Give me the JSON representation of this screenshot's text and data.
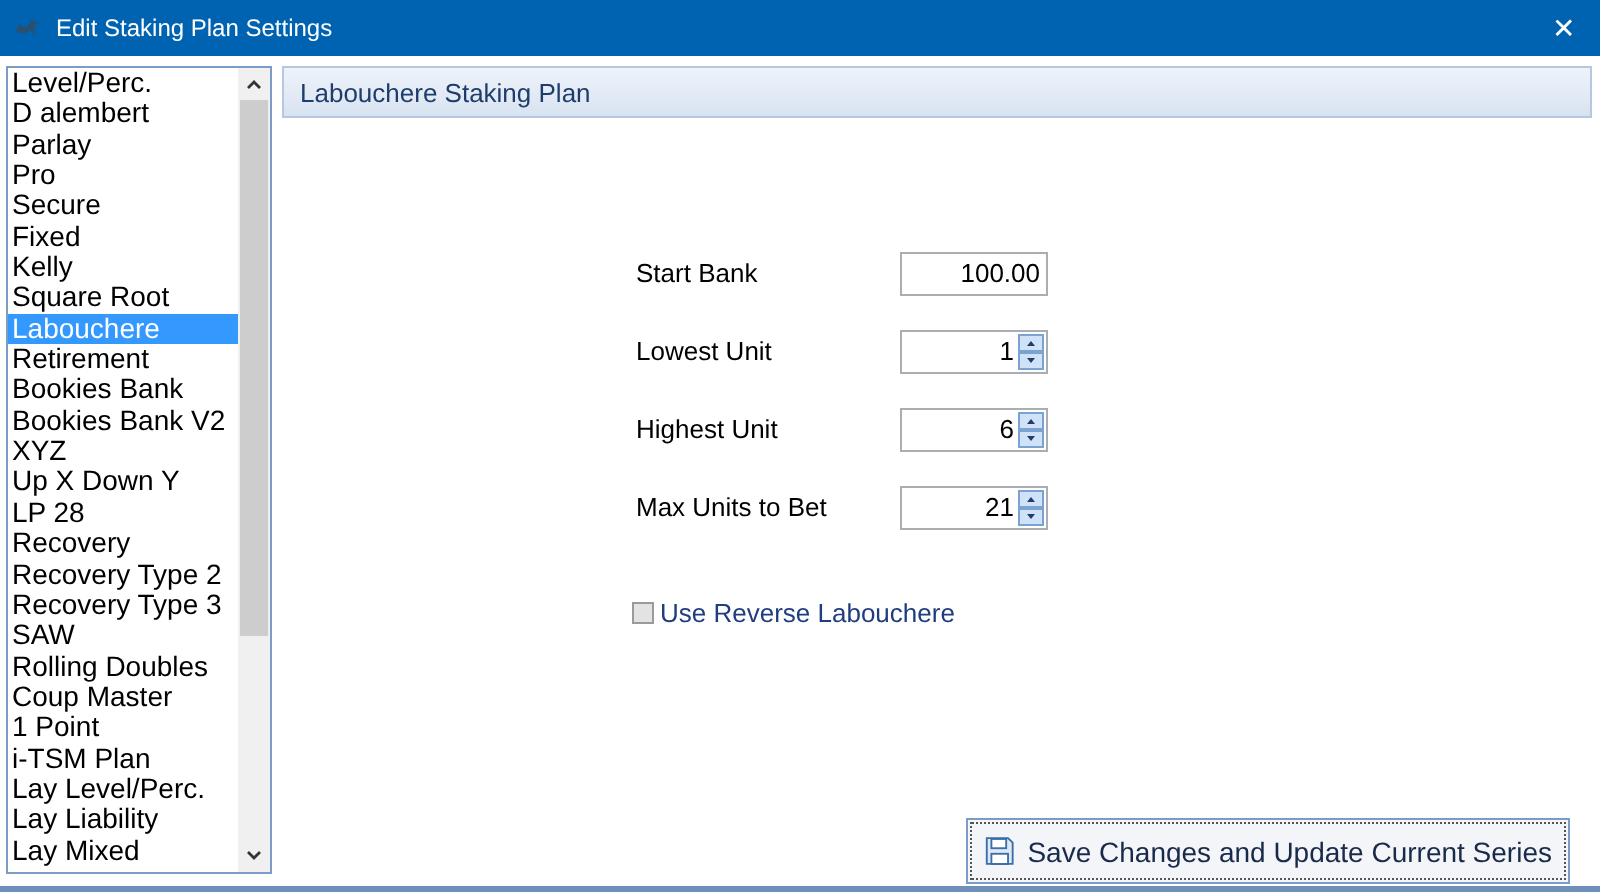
{
  "window": {
    "title": "Edit Staking Plan Settings",
    "close": "✕"
  },
  "plans": [
    {
      "label": "Level/Perc.",
      "selected": false
    },
    {
      "label": "D alembert",
      "selected": false
    },
    {
      "label": "Parlay",
      "selected": false
    },
    {
      "label": "Pro",
      "selected": false
    },
    {
      "label": "Secure",
      "selected": false
    },
    {
      "label": "Fixed",
      "selected": false
    },
    {
      "label": "Kelly",
      "selected": false
    },
    {
      "label": "Square Root",
      "selected": false
    },
    {
      "label": "Labouchere",
      "selected": true
    },
    {
      "label": "Retirement",
      "selected": false
    },
    {
      "label": "Bookies Bank",
      "selected": false
    },
    {
      "label": "Bookies Bank V2",
      "selected": false
    },
    {
      "label": "XYZ",
      "selected": false
    },
    {
      "label": "Up X Down Y",
      "selected": false
    },
    {
      "label": "LP 28",
      "selected": false
    },
    {
      "label": "Recovery",
      "selected": false
    },
    {
      "label": "Recovery Type 2",
      "selected": false
    },
    {
      "label": "Recovery Type 3",
      "selected": false
    },
    {
      "label": "SAW",
      "selected": false
    },
    {
      "label": "Rolling Doubles",
      "selected": false
    },
    {
      "label": "Coup Master",
      "selected": false
    },
    {
      "label": "1 Point",
      "selected": false
    },
    {
      "label": "i-TSM Plan",
      "selected": false
    },
    {
      "label": "Lay Level/Perc.",
      "selected": false
    },
    {
      "label": "Lay Liability",
      "selected": false
    },
    {
      "label": "Lay Mixed",
      "selected": false
    }
  ],
  "panel": {
    "title": "Labouchere Staking Plan",
    "fields": [
      {
        "label": "Start Bank",
        "value": "100.00",
        "kind": "text"
      },
      {
        "label": "Lowest Unit",
        "value": "1",
        "kind": "spin"
      },
      {
        "label": "Highest Unit",
        "value": "6",
        "kind": "spin"
      },
      {
        "label": "Max Units to Bet",
        "value": "21",
        "kind": "spin"
      }
    ],
    "reverse": {
      "label": "Use Reverse Labouchere",
      "checked": false
    },
    "save_button": "Save Changes and Update Current Series"
  }
}
